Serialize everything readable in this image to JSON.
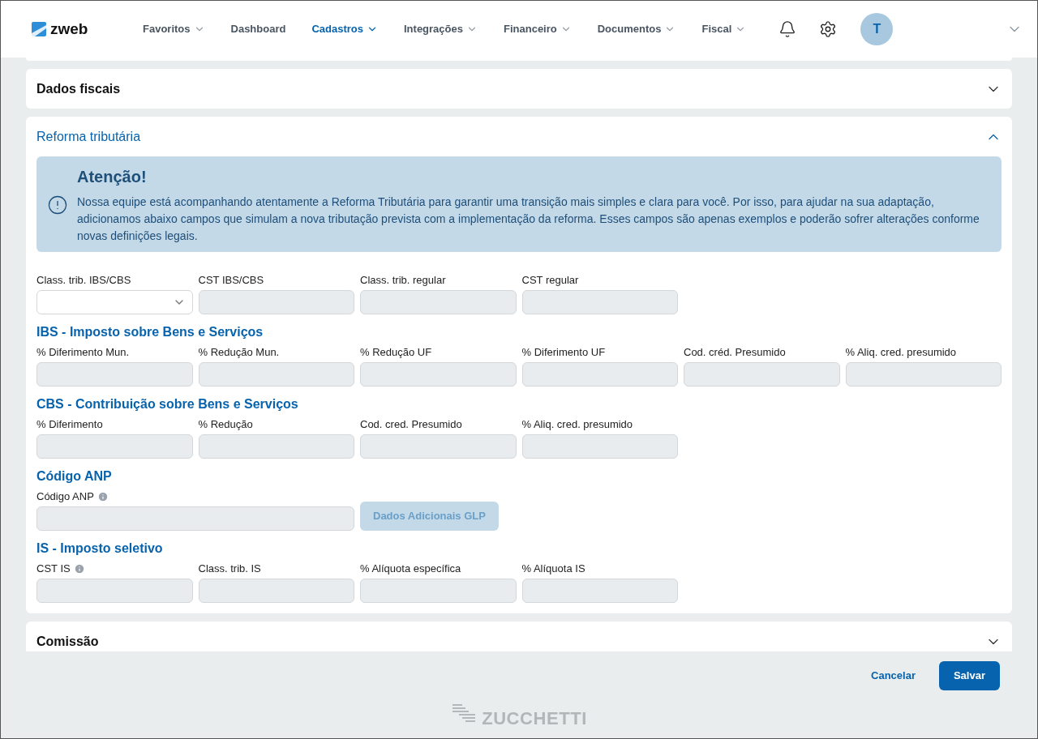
{
  "header": {
    "logo": "zweb",
    "nav": [
      {
        "label": "Favoritos",
        "dropdown": true,
        "selected": false
      },
      {
        "label": "Dashboard",
        "dropdown": false,
        "selected": false
      },
      {
        "label": "Cadastros",
        "dropdown": true,
        "selected": true
      },
      {
        "label": "Integrações",
        "dropdown": true,
        "selected": false
      },
      {
        "label": "Financeiro",
        "dropdown": true,
        "selected": false
      },
      {
        "label": "Documentos",
        "dropdown": true,
        "selected": false
      },
      {
        "label": "Fiscal",
        "dropdown": true,
        "selected": false
      }
    ],
    "avatar": "T"
  },
  "sections": [
    {
      "title": "Dados fiscais",
      "expanded": false
    },
    {
      "title": "Reforma tributária",
      "expanded": true,
      "alert": {
        "title": "Atenção!",
        "text": "Nossa equipe está acompanhando atentamente a Reforma Tributária para garantir uma transição mais simples e clara para você. Por isso, para ajudar na sua adaptação, adicionamos abaixo campos que simulam a nova tributação prevista com a implementação da reforma. Esses campos são apenas exemplos e poderão sofrer alterações conforme novas definições legais."
      },
      "groups": [
        {
          "fields": [
            {
              "label": "Class. trib. IBS/CBS",
              "kind": "select",
              "disabled": false
            },
            {
              "label": "CST IBS/CBS",
              "kind": "text",
              "disabled": true
            },
            {
              "label": "Class. trib. regular",
              "kind": "text",
              "disabled": true
            },
            {
              "label": "CST regular",
              "kind": "text",
              "disabled": true
            }
          ]
        },
        {
          "title": "IBS - Imposto sobre Bens e Serviços",
          "fields": [
            {
              "label": "% Diferimento Mun.",
              "kind": "text",
              "disabled": true
            },
            {
              "label": "% Redução Mun.",
              "kind": "text",
              "disabled": true
            },
            {
              "label": "% Redução UF",
              "kind": "text",
              "disabled": true
            },
            {
              "label": "% Diferimento UF",
              "kind": "text",
              "disabled": true
            },
            {
              "label": "Cod. créd. Presumido",
              "kind": "text",
              "disabled": true
            },
            {
              "label": "% Aliq. cred. presumido",
              "kind": "text",
              "disabled": true
            }
          ]
        },
        {
          "title": "CBS - Contribuição sobre Bens e Serviços",
          "fields": [
            {
              "label": "% Diferimento",
              "kind": "text",
              "disabled": true
            },
            {
              "label": "% Redução",
              "kind": "text",
              "disabled": true
            },
            {
              "label": "Cod. cred. Presumido",
              "kind": "text",
              "disabled": true
            },
            {
              "label": "% Aliq. cred. presumido",
              "kind": "text",
              "disabled": true
            }
          ]
        },
        {
          "title": "Código ANP",
          "fields": [
            {
              "label": "Código ANP",
              "kind": "wide",
              "info": true,
              "disabled": true
            },
            {
              "label": "Dados Adicionais GLP",
              "kind": "button",
              "disabled": true
            }
          ]
        },
        {
          "title": "IS - Imposto seletivo",
          "fields": [
            {
              "label": "CST IS",
              "kind": "text",
              "info": true,
              "disabled": true
            },
            {
              "label": "Class. trib. IS",
              "kind": "text",
              "disabled": true
            },
            {
              "label": "% Alíquota específica",
              "kind": "text",
              "disabled": true
            },
            {
              "label": "% Alíquota IS",
              "kind": "text",
              "disabled": true
            }
          ]
        }
      ]
    },
    {
      "title": "Comissão",
      "expanded": false
    }
  ],
  "footer": {
    "cancel": "Cancelar",
    "save": "Salvar",
    "brand": "ZUCCHETTI"
  }
}
